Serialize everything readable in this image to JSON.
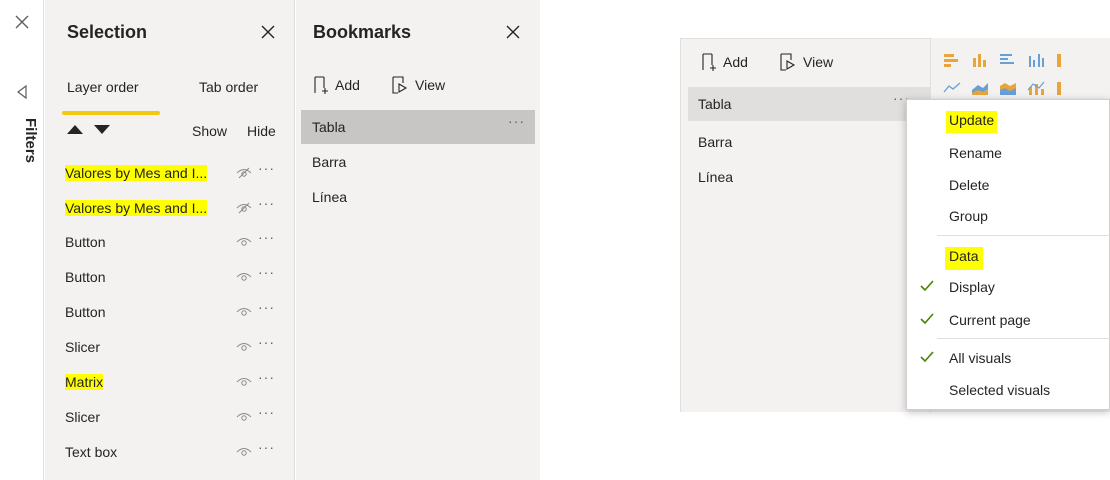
{
  "filters": {
    "label": "Filters"
  },
  "selection": {
    "title": "Selection",
    "tabs": {
      "layer_order": "Layer order",
      "tab_order": "Tab order"
    },
    "show_label": "Show",
    "hide_label": "Hide",
    "layers": [
      {
        "name": "Valores by Mes and I...",
        "visible": false,
        "highlighted": true
      },
      {
        "name": "Valores by Mes and I...",
        "visible": false,
        "highlighted": true
      },
      {
        "name": "Button",
        "visible": true,
        "highlighted": false
      },
      {
        "name": "Button",
        "visible": true,
        "highlighted": false
      },
      {
        "name": "Button",
        "visible": true,
        "highlighted": false
      },
      {
        "name": "Slicer",
        "visible": true,
        "highlighted": false
      },
      {
        "name": "Matrix",
        "visible": true,
        "highlighted": true
      },
      {
        "name": "Slicer",
        "visible": true,
        "highlighted": false
      },
      {
        "name": "Text box",
        "visible": true,
        "highlighted": false
      }
    ],
    "more_glyph": "···"
  },
  "bookmarks": {
    "title": "Bookmarks",
    "add_label": "Add",
    "view_label": "View",
    "items": [
      {
        "label": "Tabla",
        "selected": true
      },
      {
        "label": "Barra",
        "selected": false
      },
      {
        "label": "Línea",
        "selected": false
      }
    ]
  },
  "bookmarks_right": {
    "add_label": "Add",
    "view_label": "View",
    "items": [
      {
        "label": "Tabla",
        "selected": true
      },
      {
        "label": "Barra",
        "selected": false
      },
      {
        "label": "Línea",
        "selected": false
      }
    ]
  },
  "context_menu": {
    "items": [
      {
        "label": "Update",
        "highlighted": true
      },
      {
        "label": "Rename",
        "highlighted": false
      },
      {
        "label": "Delete",
        "highlighted": false
      },
      {
        "label": "Group",
        "highlighted": false
      }
    ],
    "section_label": "Data",
    "checked_items": [
      {
        "label": "Display",
        "checked": true
      },
      {
        "label": "Current page",
        "checked": true
      }
    ],
    "visual_items": [
      {
        "label": "All visuals",
        "checked": true
      },
      {
        "label": "Selected visuals",
        "checked": false
      }
    ]
  },
  "colors": {
    "accent": "#f2c811",
    "highlight": "#ffff00",
    "check": "#498205",
    "pane_bg": "#f3f2f1",
    "selected_bg": "#c8c6c4"
  }
}
